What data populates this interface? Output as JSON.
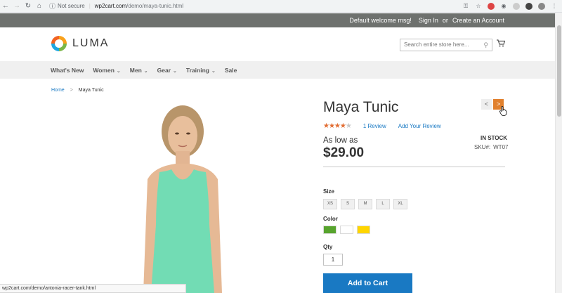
{
  "browser": {
    "not_secure": "Not secure",
    "url_host": "wp2cart.com",
    "url_path": "/demo/maya-tunic.html",
    "status_url": "wp2cart.com/demo/antonia-racer-tank.html"
  },
  "header": {
    "welcome": "Default welcome msg!",
    "sign_in": "Sign In",
    "or": "or",
    "create_account": "Create an Account",
    "logo_text": "LUMA",
    "search_placeholder": "Search entire store here..."
  },
  "nav": {
    "items": [
      {
        "label": "What's New",
        "dropdown": false
      },
      {
        "label": "Women",
        "dropdown": true
      },
      {
        "label": "Men",
        "dropdown": true
      },
      {
        "label": "Gear",
        "dropdown": true
      },
      {
        "label": "Training",
        "dropdown": true
      },
      {
        "label": "Sale",
        "dropdown": false
      }
    ]
  },
  "breadcrumb": {
    "home": "Home",
    "separator": ">",
    "current": "Maya Tunic"
  },
  "product": {
    "title": "Maya Tunic",
    "rating_stars": 4,
    "rating_max": 5,
    "review_count": "1",
    "review_label": "Review",
    "add_review": "Add Your Review",
    "stock": "IN STOCK",
    "sku_label": "SKU#:",
    "sku": "WT07",
    "as_low_as": "As low as",
    "price": "$29.00",
    "size_label": "Size",
    "sizes": [
      "XS",
      "S",
      "M",
      "L",
      "XL"
    ],
    "color_label": "Color",
    "colors": [
      "#57a42d",
      "#ffffff",
      "#ffd500"
    ],
    "qty_label": "Qty",
    "qty_value": "1",
    "add_to_cart": "Add to Cart",
    "pager_prev": "<",
    "pager_next": ">"
  }
}
